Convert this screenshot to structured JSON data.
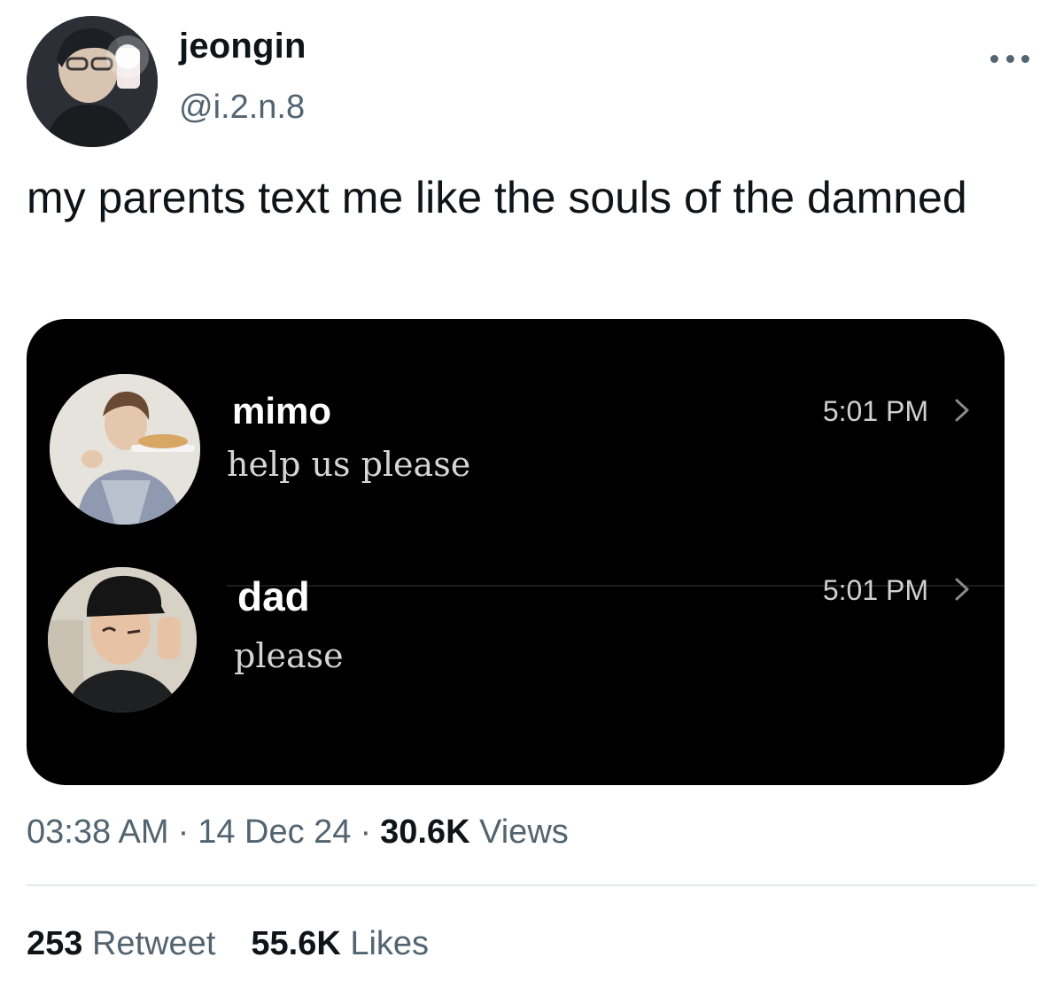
{
  "author": {
    "name": "jeongin",
    "handle": "@i.2.n.8"
  },
  "tweet": {
    "text": "my parents text me like the souls of the damned"
  },
  "media": {
    "conversations": [
      {
        "name": "mimo",
        "message": "help us please",
        "time": "5:01 PM"
      },
      {
        "name": "dad",
        "message": "please",
        "time": "5:01 PM"
      }
    ]
  },
  "meta": {
    "time": "03:38 AM",
    "date": "14 Dec 24",
    "views_count": "30.6K",
    "views_label": "Views",
    "separator": "·"
  },
  "stats": {
    "retweets_count": "253",
    "retweets_label": "Retweet",
    "likes_count": "55.6K",
    "likes_label": "Likes"
  },
  "colors": {
    "text_primary": "#0f1419",
    "text_secondary": "#536471",
    "media_background": "#000000"
  }
}
